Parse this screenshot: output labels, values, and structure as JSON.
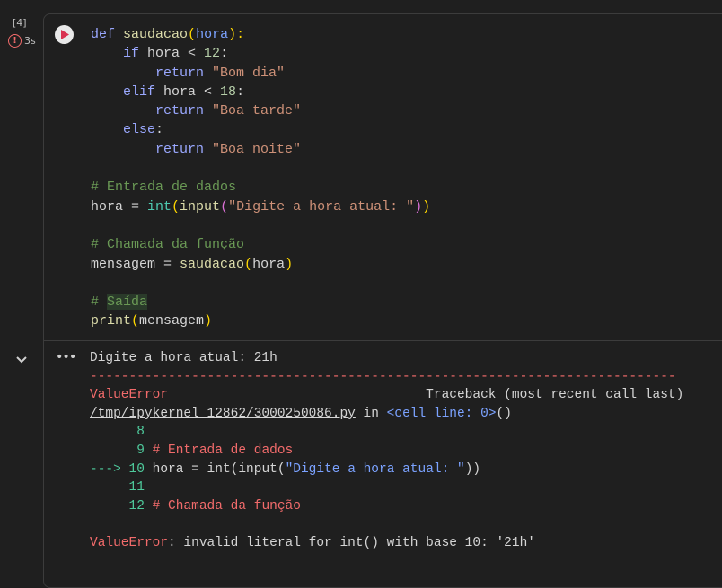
{
  "gutter": {
    "execution_count": "[4]",
    "exec_time": "3s"
  },
  "code": {
    "l1": {
      "def": "def",
      "name": "saudacao",
      "open": "(",
      "param": "hora",
      "close": "):"
    },
    "l2": {
      "kw": "if",
      "rest": " hora < ",
      "num": "12",
      "end": ":"
    },
    "l3": {
      "kw": "return",
      "str": "\"Bom dia\""
    },
    "l4": {
      "kw": "elif",
      "rest": " hora < ",
      "num": "18",
      "end": ":"
    },
    "l5": {
      "kw": "return",
      "str": "\"Boa tarde\""
    },
    "l6": {
      "kw": "else",
      "end": ":"
    },
    "l7": {
      "kw": "return",
      "str": "\"Boa noite\""
    },
    "l9": "# Entrada de dados",
    "l10": {
      "var": "hora = ",
      "int": "int",
      "p1": "(",
      "input": "input",
      "p2": "(",
      "str": "\"Digite a hora atual: \"",
      "p3": ")",
      "p4": ")"
    },
    "l12": "# Chamada da função",
    "l13": {
      "var": "mensagem = ",
      "fn": "saudacao",
      "p1": "(",
      "arg": "hora",
      "p2": ")"
    },
    "l15a": "# ",
    "l15b": "Saída",
    "l16": {
      "fn": "print",
      "p1": "(",
      "arg": "mensagem",
      "p2": ")"
    }
  },
  "output": {
    "prompt_line": "Digite a hora atual: 21h",
    "separator": "---------------------------------------------------------------------------",
    "error_name": "ValueError",
    "traceback_header": "Traceback (most recent call last)",
    "file_link": "/tmp/ipykernel_12862/3000250086.py",
    "in_text": " in ",
    "cell_line": "<cell line: 0>",
    "cell_line_paren": "()",
    "tb_l8": "8",
    "tb_l9_num": "9",
    "tb_l9_text": "# Entrada de dados",
    "tb_arrow": "--->",
    "tb_l10_num": "10",
    "tb_l10_a": "hora = ",
    "tb_l10_int": "int",
    "tb_l10_b": "(",
    "tb_l10_input": "input",
    "tb_l10_c": "(",
    "tb_l10_str": "\"Digite a hora atual: \"",
    "tb_l10_d": "))",
    "tb_l11": "11",
    "tb_l12_num": "12",
    "tb_l12_text": "# Chamada da função",
    "final_error": "ValueError",
    "final_msg": ": invalid literal for int() with base 10: '21h'"
  },
  "colors": {
    "error": "#f26b6b",
    "keyword": "#9aa8ff",
    "string": "#ce9178",
    "comment": "#6a9955"
  }
}
